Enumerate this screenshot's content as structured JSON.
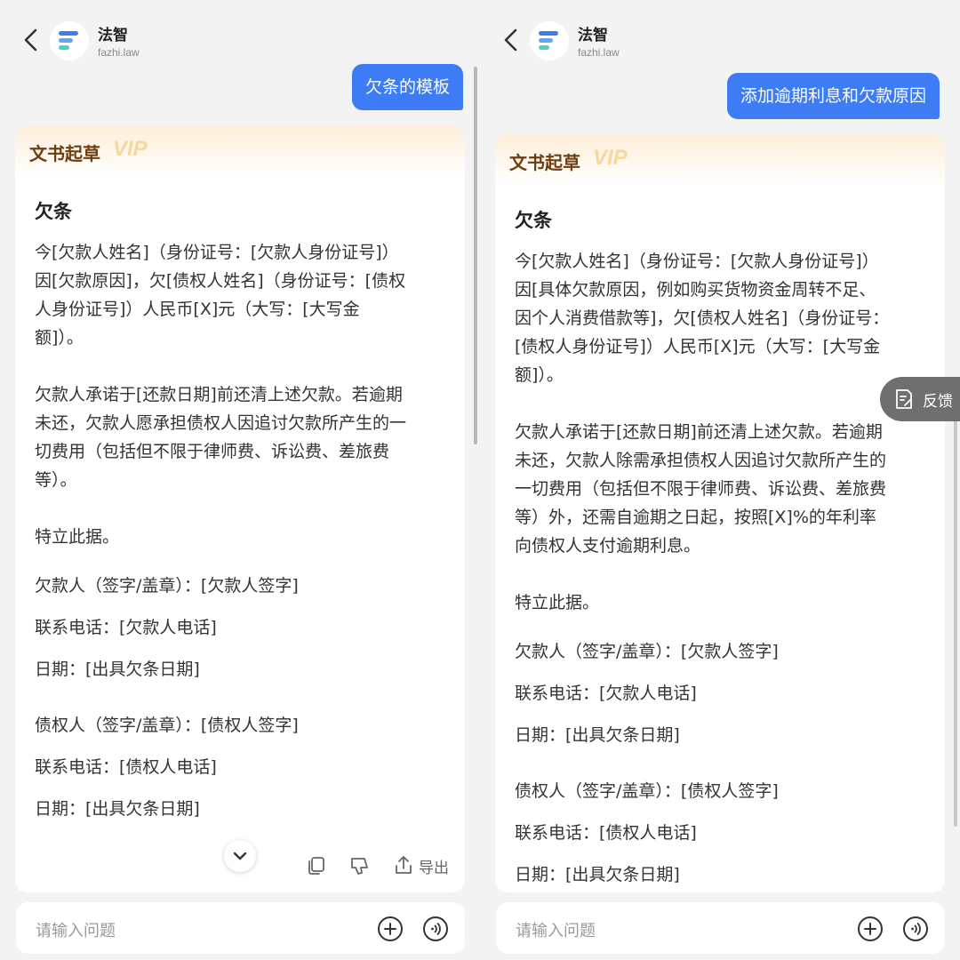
{
  "app": {
    "name": "法智",
    "domain": "fazhi.law"
  },
  "left": {
    "user_message": "欠条的模板",
    "card_label": "文书起草",
    "vip_label": "VIP",
    "doc_title": "欠条",
    "para1": [
      "今[欠款人姓名]（身份证号：[欠款人身份证号]）",
      "因[欠款原因]，欠[债权人姓名]（身份证号：[债权",
      "人身份证号]）人民币[X]元（大写：[大写金",
      "额]）。"
    ],
    "para2": [
      "欠款人承诺于[还款日期]前还清上述欠款。若逾期",
      "未还，欠款人愿承担债权人因追讨欠款所产生的一",
      "切费用（包括但不限于律师费、诉讼费、差旅费",
      "等）。"
    ],
    "closing": "特立此据。",
    "debtor_sign": "欠款人（签字/盖章）：[欠款人签字]",
    "debtor_phone": "联系电话：[欠款人电话]",
    "debtor_date": "日期：[出具欠条日期]",
    "creditor_sign": "债权人（签字/盖章）：[债权人签字]",
    "creditor_phone": "联系电话：[债权人电话]",
    "creditor_date": "日期：[出具欠条日期]",
    "export_label": "导出"
  },
  "right": {
    "user_message": "添加逾期利息和欠款原因",
    "card_label": "文书起草",
    "vip_label": "VIP",
    "doc_title": "欠条",
    "para1": [
      "今[欠款人姓名]（身份证号：[欠款人身份证号]）",
      "因[具体欠款原因，例如购买货物资金周转不足、",
      "因个人消费借款等]，欠[债权人姓名]（身份证号：",
      "[债权人身份证号]）人民币[X]元（大写：[大写金",
      "额]）。"
    ],
    "para2": [
      "欠款人承诺于[还款日期]前还清上述欠款。若逾期",
      "未还，欠款人除需承担债权人因追讨欠款所产生的",
      "一切费用（包括但不限于律师费、诉讼费、差旅费",
      "等）外，还需自逾期之日起，按照[X]%的年利率",
      "向债权人支付逾期利息。"
    ],
    "closing": "特立此据。",
    "debtor_sign": "欠款人（签字/盖章）：[欠款人签字]",
    "debtor_phone": "联系电话：[欠款人电话]",
    "debtor_date": "日期：[出具欠条日期]",
    "creditor_sign": "债权人（签字/盖章）：[债权人签字]",
    "creditor_phone": "联系电话：[债权人电话]",
    "creditor_date": "日期：[出具欠条日期]"
  },
  "input": {
    "placeholder": "请输入问题"
  },
  "feedback_label": "反馈",
  "colors": {
    "accent": "#3d7cf5",
    "card_label": "#6e3d10",
    "vip": "#f7d89c"
  }
}
